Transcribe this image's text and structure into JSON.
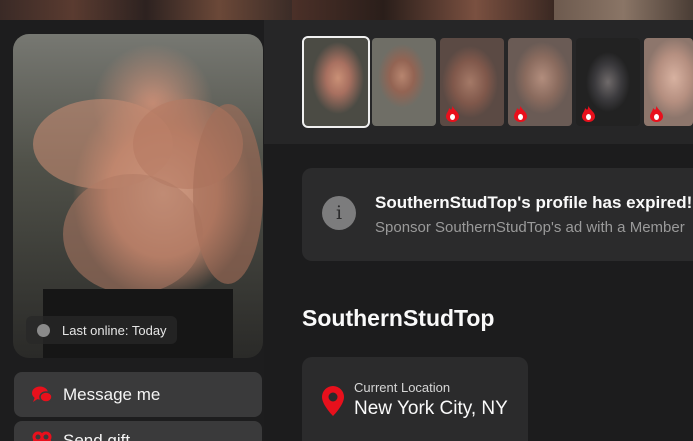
{
  "profile": {
    "username": "SouthernStudTop",
    "last_online": "Last online: Today"
  },
  "actions": {
    "message_label": "Message me",
    "gift_label": "Send gift"
  },
  "notice": {
    "title": "SouthernStudTop's profile has expired!",
    "subtitle": "Sponsor SouthernStudTop's ad with a Member"
  },
  "location": {
    "label": "Current Location",
    "value": "New York City, NY"
  },
  "thumbnails": [
    {
      "selected": true,
      "locked": false
    },
    {
      "selected": false,
      "locked": false
    },
    {
      "selected": false,
      "locked": true
    },
    {
      "selected": false,
      "locked": true
    },
    {
      "selected": false,
      "locked": true
    },
    {
      "selected": false,
      "locked": true
    }
  ],
  "colors": {
    "accent": "#e8101c",
    "background": "#1d1d1e",
    "card": "#2b2b2c",
    "button": "#3a3a3b"
  },
  "icons": {
    "message": "chat-bubbles-icon",
    "gift": "gift-icon",
    "info": "info-icon",
    "location": "location-pin-icon",
    "locked_photo": "flame-icon"
  }
}
